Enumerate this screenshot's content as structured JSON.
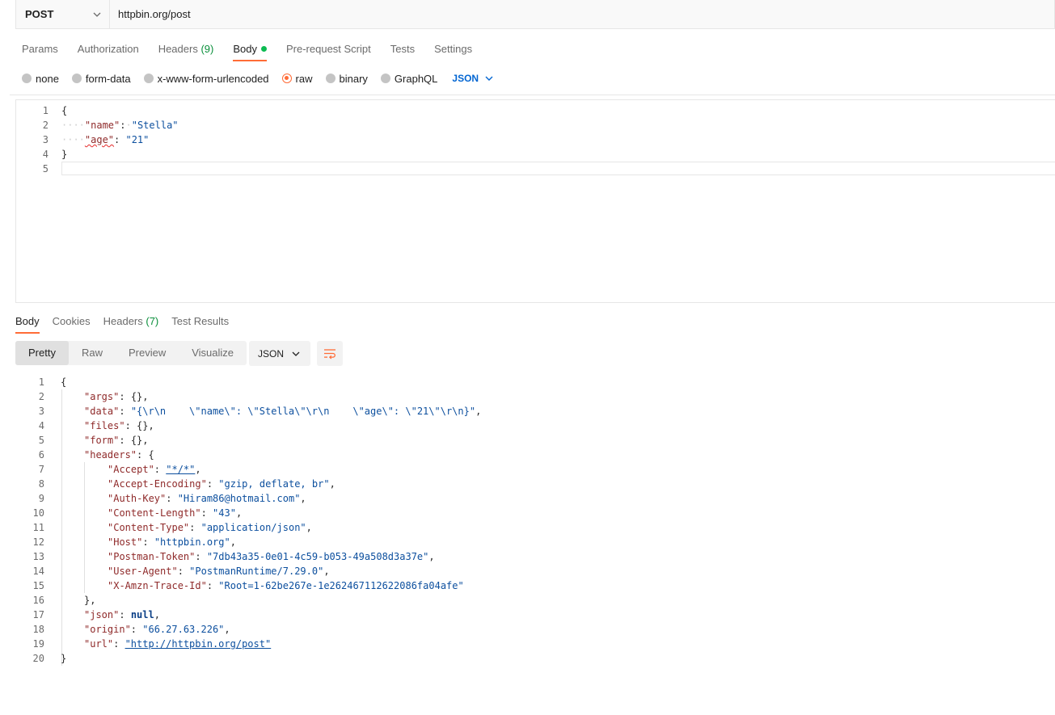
{
  "request": {
    "method": "POST",
    "url": "httpbin.org/post"
  },
  "request_tabs": [
    {
      "label": "Params",
      "count": ""
    },
    {
      "label": "Authorization",
      "count": ""
    },
    {
      "label": "Headers",
      "count": "(9)"
    },
    {
      "label": "Body",
      "count": ""
    },
    {
      "label": "Pre-request Script",
      "count": ""
    },
    {
      "label": "Tests",
      "count": ""
    },
    {
      "label": "Settings",
      "count": ""
    }
  ],
  "body_types": [
    "none",
    "form-data",
    "x-www-form-urlencoded",
    "raw",
    "binary",
    "GraphQL"
  ],
  "body_type_selected": "raw",
  "body_language": "JSON",
  "request_body": {
    "line_numbers": [
      "1",
      "2",
      "3",
      "4",
      "5"
    ],
    "open_brace": "{",
    "close_brace": "}",
    "name_key": "\"name\"",
    "name_value": "\"Stella\"",
    "age_key": "\"age\"",
    "age_value": "\"21\""
  },
  "response_tabs": [
    {
      "label": "Body",
      "count": ""
    },
    {
      "label": "Cookies",
      "count": ""
    },
    {
      "label": "Headers",
      "count": "(7)"
    },
    {
      "label": "Test Results",
      "count": ""
    }
  ],
  "view_modes": [
    "Pretty",
    "Raw",
    "Preview",
    "Visualize"
  ],
  "view_mode_selected": "Pretty",
  "response_format": "JSON",
  "response_body": {
    "line_numbers": [
      "1",
      "2",
      "3",
      "4",
      "5",
      "6",
      "7",
      "8",
      "9",
      "10",
      "11",
      "12",
      "13",
      "14",
      "15",
      "16",
      "17",
      "18",
      "19",
      "20"
    ],
    "args": {
      "key": "\"args\"",
      "value": "{}"
    },
    "data": {
      "key": "\"data\"",
      "value": "\"{\\r\\n    \\\"name\\\": \\\"Stella\\\"\\r\\n    \\\"age\\\": \\\"21\\\"\\r\\n}\""
    },
    "files": {
      "key": "\"files\"",
      "value": "{}"
    },
    "form": {
      "key": "\"form\"",
      "value": "{}"
    },
    "headers_key": "\"headers\"",
    "headers": [
      {
        "key": "\"Accept\"",
        "value": "\"*/*\""
      },
      {
        "key": "\"Accept-Encoding\"",
        "value": "\"gzip, deflate, br\""
      },
      {
        "key": "\"Auth-Key\"",
        "value": "\"Hiram86@hotmail.com\""
      },
      {
        "key": "\"Content-Length\"",
        "value": "\"43\""
      },
      {
        "key": "\"Content-Type\"",
        "value": "\"application/json\""
      },
      {
        "key": "\"Host\"",
        "value": "\"httpbin.org\""
      },
      {
        "key": "\"Postman-Token\"",
        "value": "\"7db43a35-0e01-4c59-b053-49a508d3a37e\""
      },
      {
        "key": "\"User-Agent\"",
        "value": "\"PostmanRuntime/7.29.0\""
      },
      {
        "key": "\"X-Amzn-Trace-Id\"",
        "value": "\"Root=1-62be267e-1e262467112622086fa04afe\""
      }
    ],
    "json": {
      "key": "\"json\"",
      "value": "null"
    },
    "origin": {
      "key": "\"origin\"",
      "value": "\"66.27.63.226\""
    },
    "url": {
      "key": "\"url\"",
      "value": "\"http://httpbin.org/post\""
    }
  },
  "icons": {
    "method_dropdown": "chevron-down-icon",
    "language_dropdown": "chevron-down-icon",
    "format_dropdown": "chevron-down-icon",
    "wrap": "wrap-lines-icon",
    "body_indicator": "green-dot-icon"
  },
  "colors": {
    "accent": "#ff6c37",
    "link_blue": "#0265d2",
    "count_green": "#0a8f3b",
    "dot_green": "#0cbb52",
    "json_key": "#8f2a2a",
    "json_string": "#0c4f9e"
  }
}
